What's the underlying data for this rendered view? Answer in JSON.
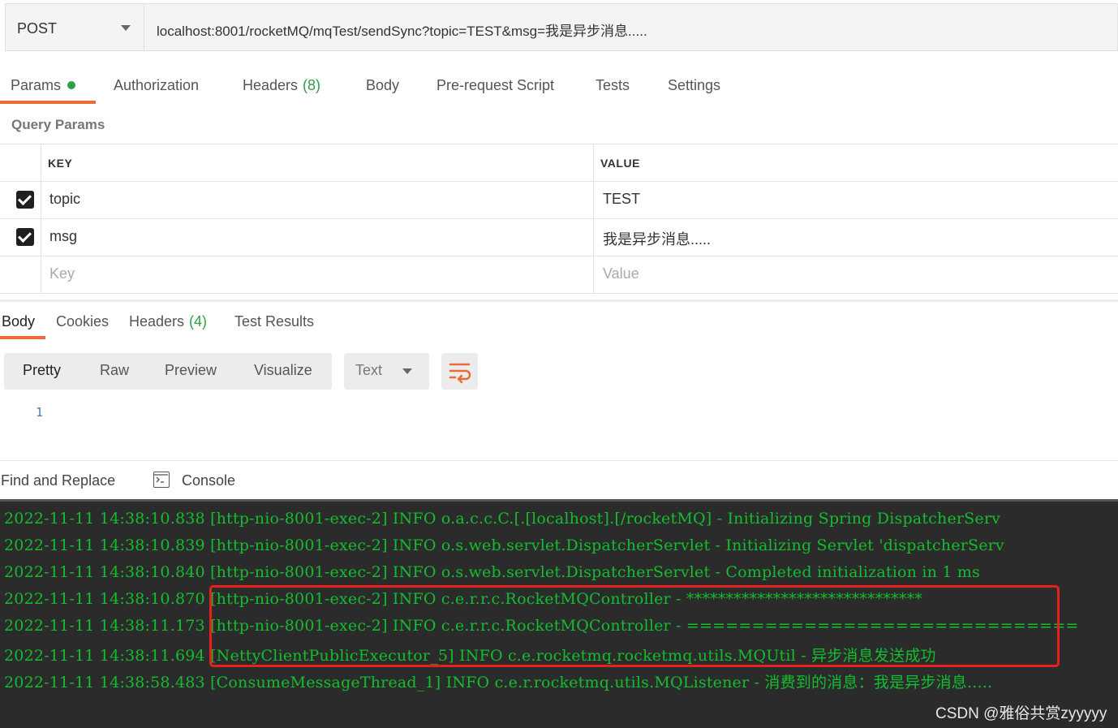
{
  "request": {
    "method": "POST",
    "url": "localhost:8001/rocketMQ/mqTest/sendSync?topic=TEST&msg=我是异步消息....."
  },
  "request_tabs": [
    {
      "label": "Params",
      "count": ""
    },
    {
      "label": "Authorization",
      "count": ""
    },
    {
      "label": "Headers",
      "count": "(8)"
    },
    {
      "label": "Body",
      "count": ""
    },
    {
      "label": "Pre-request Script",
      "count": ""
    },
    {
      "label": "Tests",
      "count": ""
    },
    {
      "label": "Settings",
      "count": ""
    }
  ],
  "query_params": {
    "title": "Query Params",
    "columns": [
      "KEY",
      "VALUE"
    ],
    "rows": [
      {
        "checked": true,
        "key": "topic",
        "value": "TEST"
      },
      {
        "checked": true,
        "key": "msg",
        "value": "我是异步消息....."
      }
    ],
    "placeholder_key": "Key",
    "placeholder_value": "Value"
  },
  "response_tabs": [
    {
      "label": "Body",
      "count": ""
    },
    {
      "label": "Cookies",
      "count": ""
    },
    {
      "label": "Headers",
      "count": "(4)"
    },
    {
      "label": "Test Results",
      "count": ""
    }
  ],
  "view_modes": [
    "Pretty",
    "Raw",
    "Preview",
    "Visualize"
  ],
  "format": "Text",
  "line_number": "1",
  "footer": {
    "find_replace": "Find and Replace",
    "console": "Console"
  },
  "console_lines": [
    "2022-11-11 14:38:10.838 [http-nio-8001-exec-2] INFO  o.a.c.c.C.[.[localhost].[/rocketMQ] - Initializing Spring DispatcherServ",
    "2022-11-11 14:38:10.839 [http-nio-8001-exec-2] INFO  o.s.web.servlet.DispatcherServlet - Initializing Servlet 'dispatcherServ",
    "2022-11-11 14:38:10.840 [http-nio-8001-exec-2] INFO  o.s.web.servlet.DispatcherServlet - Completed initialization in 1 ms",
    "2022-11-11 14:38:10.870 [http-nio-8001-exec-2] INFO  c.e.r.r.c.RocketMQController - ******************************",
    "2022-11-11 14:38:11.173 [http-nio-8001-exec-2] INFO  c.e.r.r.c.RocketMQController - ==============================",
    "2022-11-11 14:38:11.694 [NettyClientPublicExecutor_5] INFO  c.e.rocketmq.rocketmq.utils.MQUtil - 异步消息发送成功",
    "2022-11-11 14:38:58.483 [ConsumeMessageThread_1] INFO  c.e.r.rocketmq.utils.MQListener - 消费到的消息：我是异步消息....."
  ],
  "watermark": "CSDN @雅俗共赏zyyyyy",
  "colors": {
    "accent": "#ed6b34",
    "count_green": "#2f9e44",
    "console_text": "#13bd2e",
    "console_bg": "#2b2b2b",
    "highlight": "#e8201b"
  }
}
